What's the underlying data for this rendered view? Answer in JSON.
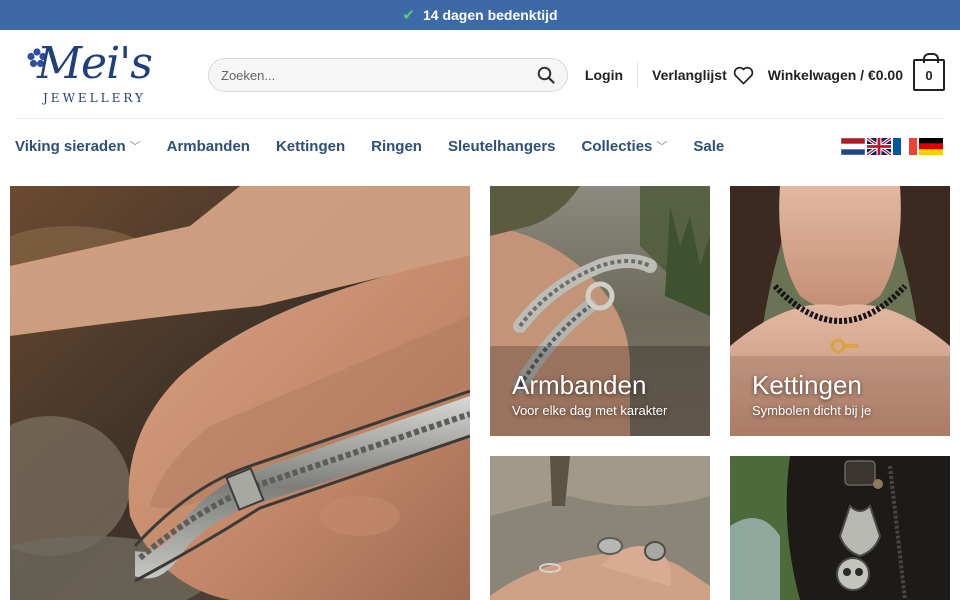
{
  "topbar": {
    "check_icon": "check-icon",
    "text": "14 dagen bedenktijd"
  },
  "logo": {
    "script": "Mei's",
    "sub": "JEWELLERY"
  },
  "search": {
    "placeholder": "Zoeken..."
  },
  "header": {
    "login": "Login",
    "wishlist": "Verlanglijst",
    "cart_label": "Winkelwagen / €0.00",
    "cart_count": "0"
  },
  "nav": {
    "items": [
      {
        "label": "Viking sieraden",
        "dropdown": true
      },
      {
        "label": "Armbanden",
        "dropdown": false
      },
      {
        "label": "Kettingen",
        "dropdown": false
      },
      {
        "label": "Ringen",
        "dropdown": false
      },
      {
        "label": "Sleutelhangers",
        "dropdown": false
      },
      {
        "label": "Collecties",
        "dropdown": true
      },
      {
        "label": "Sale",
        "dropdown": false
      }
    ]
  },
  "flags": [
    "dutch-flag-icon",
    "uk-flag-icon",
    "french-flag-icon",
    "german-flag-icon"
  ],
  "tiles": {
    "armbanden": {
      "title": "Armbanden",
      "subtitle": "Voor elke dag met karakter"
    },
    "kettingen": {
      "title": "Kettingen",
      "subtitle": "Symbolen dicht bij je"
    }
  },
  "colors": {
    "topbar": "#3d6aa6",
    "nav_text": "#2c4f7c",
    "logo": "#1f3f7d"
  }
}
